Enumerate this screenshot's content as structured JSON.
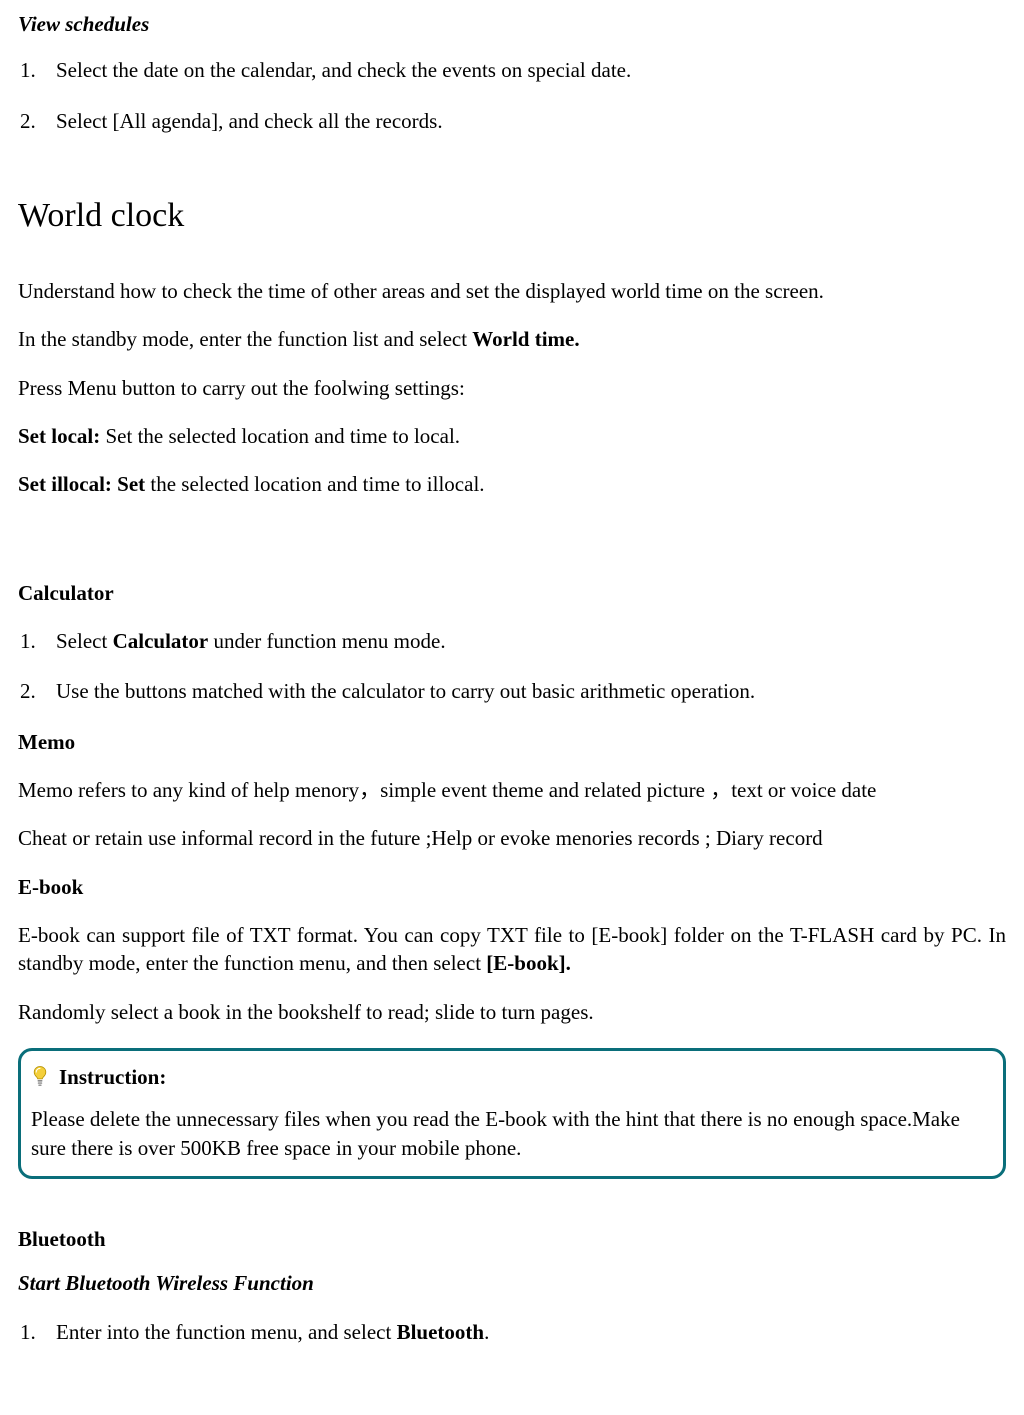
{
  "viewSchedules": {
    "title": "View schedules",
    "items": [
      {
        "n": "1.",
        "text": "Select the date on the calendar, and check the events on special date."
      },
      {
        "n": "2.",
        "text": "Select [All agenda], and check all the records."
      }
    ]
  },
  "worldClock": {
    "title": "World clock",
    "intro": "Understand how to check the time of other areas and set the displayed world time on the screen.",
    "standbyPrefix": "In the standby mode, enter the function list and select ",
    "standbyBold": "World time.",
    "press": "Press Menu button to carry out the foolwing settings:",
    "setLocalBold": "Set local: ",
    "setLocalRest": "Set the selected location and time to local.",
    "setIllocalBold": "Set illocal: Set ",
    "setIllocalRest": "the selected location and time to illocal."
  },
  "calculator": {
    "title": "Calculator",
    "items": [
      {
        "n": "1.",
        "prefix": "Select ",
        "bold": "Calculator",
        "suffix": " under function menu mode."
      },
      {
        "n": "2.",
        "text": "Use the buttons matched with the calculator to carry out basic arithmetic operation."
      }
    ]
  },
  "memo": {
    "title": "Memo",
    "p1": "Memo refers to any kind of help menory，simple event theme and related picture   ，text or voice date",
    "p2": "Cheat or retain use informal record in the future ;Help or evoke menories records ; Diary record"
  },
  "ebook": {
    "title": "E-book",
    "p1prefix": "E-book can support file of TXT format. You can copy TXT file to [E-book] folder on the T-FLASH card by PC. In standby mode, enter the function menu, and then select ",
    "p1bold": "[E-book].",
    "p2": "Randomly select a book in the bookshelf to read; slide to turn pages."
  },
  "instruction": {
    "label": "Instruction:",
    "body": "Please delete the unnecessary files when you read the E-book with the hint that there is no enough space.Make sure there is over 500KB free space in your mobile phone."
  },
  "bluetooth": {
    "title": "Bluetooth",
    "subtitle": "Start Bluetooth Wireless Function",
    "items": [
      {
        "n": "1.",
        "prefix": "Enter into the function menu, and select ",
        "bold": "Bluetooth",
        "suffix": "."
      }
    ]
  }
}
